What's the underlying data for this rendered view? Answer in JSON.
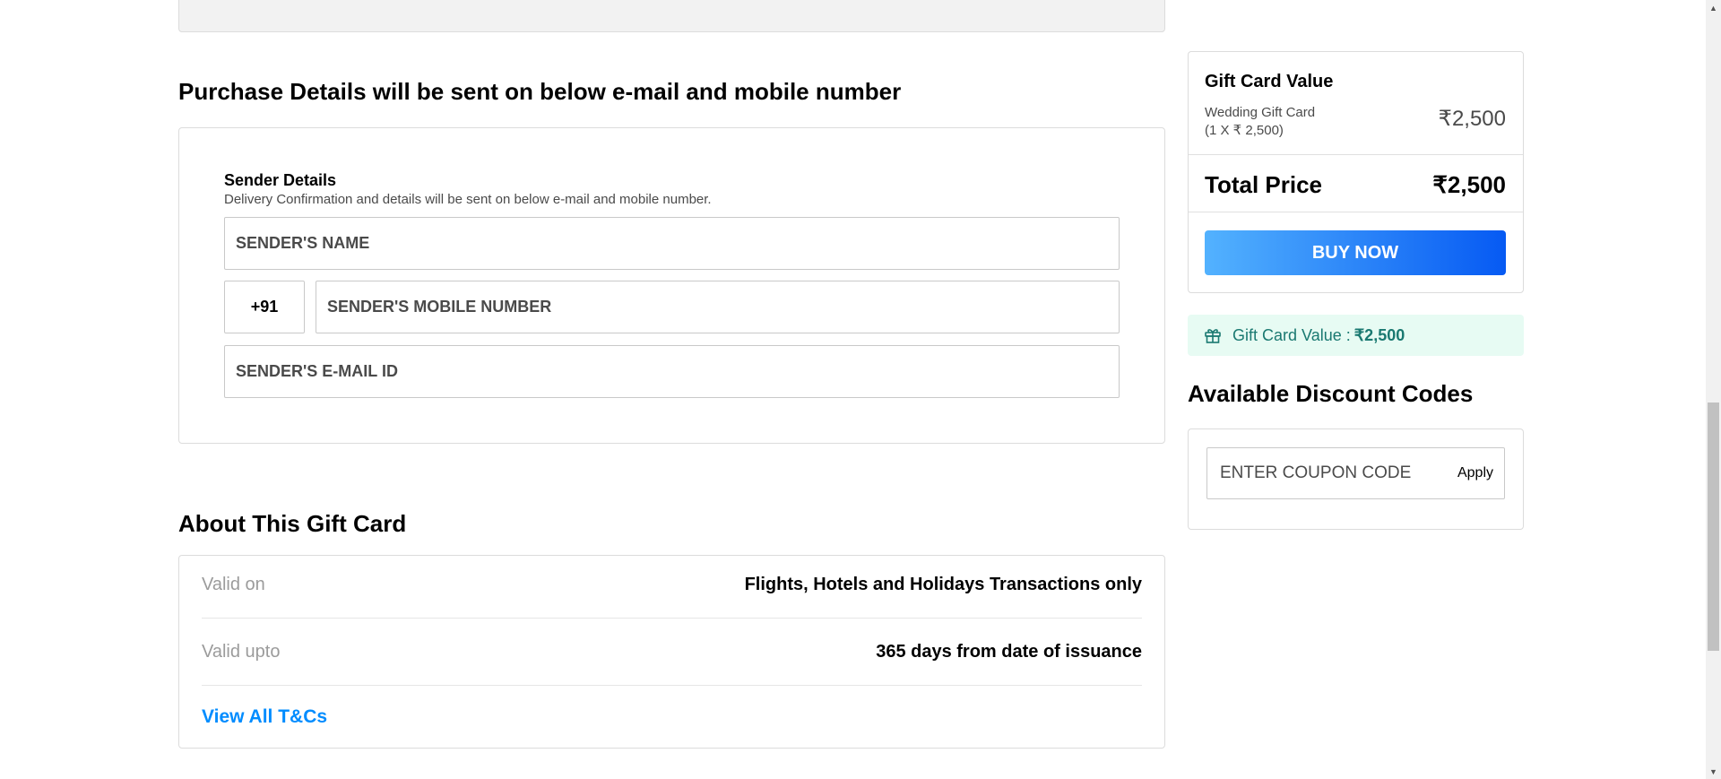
{
  "purchase": {
    "heading": "Purchase Details will be sent on below e-mail and mobile number",
    "sender_title": "Sender Details",
    "sender_subtitle": "Delivery Confirmation and details will be sent on below e-mail and mobile number.",
    "name_placeholder": "SENDER'S NAME",
    "country_code": "+91",
    "mobile_placeholder": "SENDER'S MOBILE NUMBER",
    "email_placeholder": "SENDER'S E-MAIL ID"
  },
  "about": {
    "heading": "About This Gift Card",
    "rows": [
      {
        "label": "Valid on",
        "value": "Flights, Hotels and Holidays Transactions only"
      },
      {
        "label": "Valid upto",
        "value": "365 days from date of issuance"
      }
    ],
    "tnc_link": "View All T&Cs"
  },
  "summary": {
    "title": "Gift Card Value",
    "item_name": "Wedding Gift Card",
    "item_qty": "(1 X ₹ 2,500)",
    "item_price": "₹2,500",
    "total_label": "Total Price",
    "total_value": "₹2,500",
    "buy_label": "BUY NOW"
  },
  "note": {
    "icon": "gift-icon",
    "label": "Gift Card Value :",
    "value": "₹2,500"
  },
  "discount": {
    "heading": "Available Discount Codes",
    "coupon_placeholder": "ENTER COUPON CODE",
    "apply_label": "Apply"
  },
  "colors": {
    "link_blue": "#008cff",
    "buy_gradient_start": "#53b2fe",
    "buy_gradient_end": "#065af3",
    "note_bg": "#e7fbf3",
    "note_text": "#1a7971"
  }
}
